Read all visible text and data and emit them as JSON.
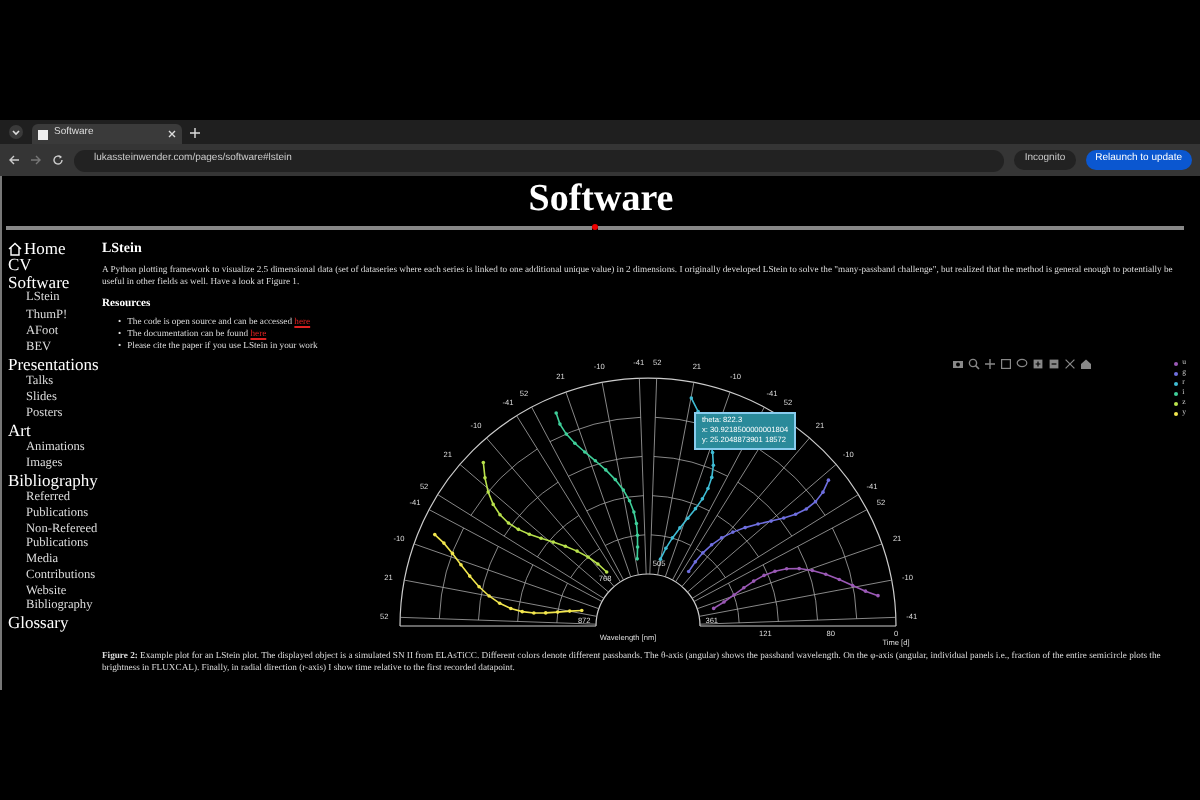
{
  "browser": {
    "tab_title": "Software",
    "url": "lukassteinwender.com/pages/software#lstein",
    "incognito_label": "Incognito",
    "update_button": "Relaunch to update"
  },
  "page_title": "Software",
  "sidebar": {
    "items": [
      {
        "label": "Home",
        "kind": "home"
      },
      {
        "label": "CV",
        "kind": "link"
      },
      {
        "label": "Software",
        "children": [
          {
            "label": "LStein"
          },
          {
            "label": "ThumP!"
          },
          {
            "label": "AFoot"
          },
          {
            "label": "BEV"
          }
        ]
      },
      {
        "label": "Presentations",
        "children": [
          {
            "label": "Talks"
          },
          {
            "label": "Slides"
          },
          {
            "label": "Posters"
          }
        ]
      },
      {
        "label": "Art",
        "children": [
          {
            "label": "Animations"
          },
          {
            "label": "Images"
          }
        ]
      },
      {
        "label": "Bibliography",
        "children": [
          {
            "label": "Referred Publications"
          },
          {
            "label": "Non-Refereed Publications"
          },
          {
            "label": "Media Contributions"
          },
          {
            "label": "Website Bibliography"
          }
        ]
      },
      {
        "label": "Glossary"
      }
    ]
  },
  "section": {
    "heading": "LStein",
    "intro": "A Python plotting framework to visualize 2.5 dimensional data (set of dataseries where each series is linked to one additional unique value) in 2 dimensions. I originally developed LStein to solve the \"many-passband challenge\", but realized that the method is general enough to potentially be useful in other fields as well. Have a look at Figure 1.",
    "resources_heading": "Resources",
    "resources": [
      {
        "marker": "•",
        "text": "The code is open source and can be accessed",
        "link": "here"
      },
      {
        "marker": "•",
        "text": "The documentation can be found",
        "link": "here"
      },
      {
        "marker": "•",
        "text": "Please cite the paper if you use LStein in your work"
      }
    ]
  },
  "figure": {
    "chart": {
      "bands": [
        {
          "label": "u",
          "color": "#9b59b6",
          "ticks": [
            "-41",
            "-10",
            "21",
            "52"
          ]
        },
        {
          "label": "g",
          "color": "#6f6fe0",
          "ticks": [
            "-41",
            "-10",
            "21",
            "52"
          ]
        },
        {
          "label": "r",
          "color": "#3fbcd4",
          "ticks": [
            "-41",
            "-10",
            "21",
            "52"
          ]
        },
        {
          "label": "i",
          "color": "#3fcf9a",
          "ticks": [
            "-41",
            "-10",
            "21",
            "52"
          ]
        },
        {
          "label": "z",
          "color": "#b9e24c",
          "ticks": [
            "-41",
            "-10",
            "21",
            "52"
          ]
        },
        {
          "label": "y",
          "color": "#f2e64e",
          "ticks": [
            "-41",
            "-10",
            "21",
            "52"
          ]
        }
      ],
      "wavelength_labels": [
        "361",
        "505",
        "768",
        "872"
      ],
      "time_ticks": [
        "121",
        "80",
        "0"
      ],
      "xlabel": "Wavelength [nm]",
      "time_label": "Time [d]",
      "tooltip": [
        "theta: 822.3",
        "x: 30.9218500000001804",
        "y: 25.2048873901 18572"
      ]
    },
    "caption": "**Figure 2:** Example plot for an LStein plot. The displayed object is a simulated SN II from ELAsTiCC. Different colors denote different passbands. The θ-axis (angular) shows the passband wavelength. On the φ-axis (angular, individual panels i.e., fraction of the entire semicircle plots the brightness in FLUXCAL). Finally, in radial direction (r-axis) I show time relative to the first recorded datapoint."
  }
}
